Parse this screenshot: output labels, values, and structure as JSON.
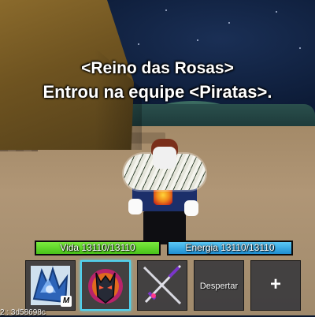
{
  "notification": {
    "line1": "<Reino das Rosas>",
    "line2": "Entrou na equipe <Piratas>."
  },
  "stats": {
    "health_label": "Vida 13110/13110",
    "health_fraction": 1.0,
    "energy_label": "Energia 13110/13110",
    "energy_fraction": 1.0
  },
  "hotbar": {
    "slots": [
      {
        "name": "fighting-style-item",
        "icon": "blue-claw-icon",
        "badge": "M",
        "selected": false
      },
      {
        "name": "devil-fruit-item",
        "icon": "horned-mask-icon",
        "selected": true
      },
      {
        "name": "swords-item",
        "icon": "crossed-swords-icon",
        "selected": false
      },
      {
        "name": "awaken-slot",
        "label": "Despertar",
        "selected": false
      },
      {
        "name": "add-slot",
        "label": "+",
        "selected": false
      }
    ]
  },
  "session_id": "2 : 3d58698c",
  "colors": {
    "health": "#49c21a",
    "energy": "#1f8ed0",
    "selected_slot": "#4fd2f0"
  }
}
